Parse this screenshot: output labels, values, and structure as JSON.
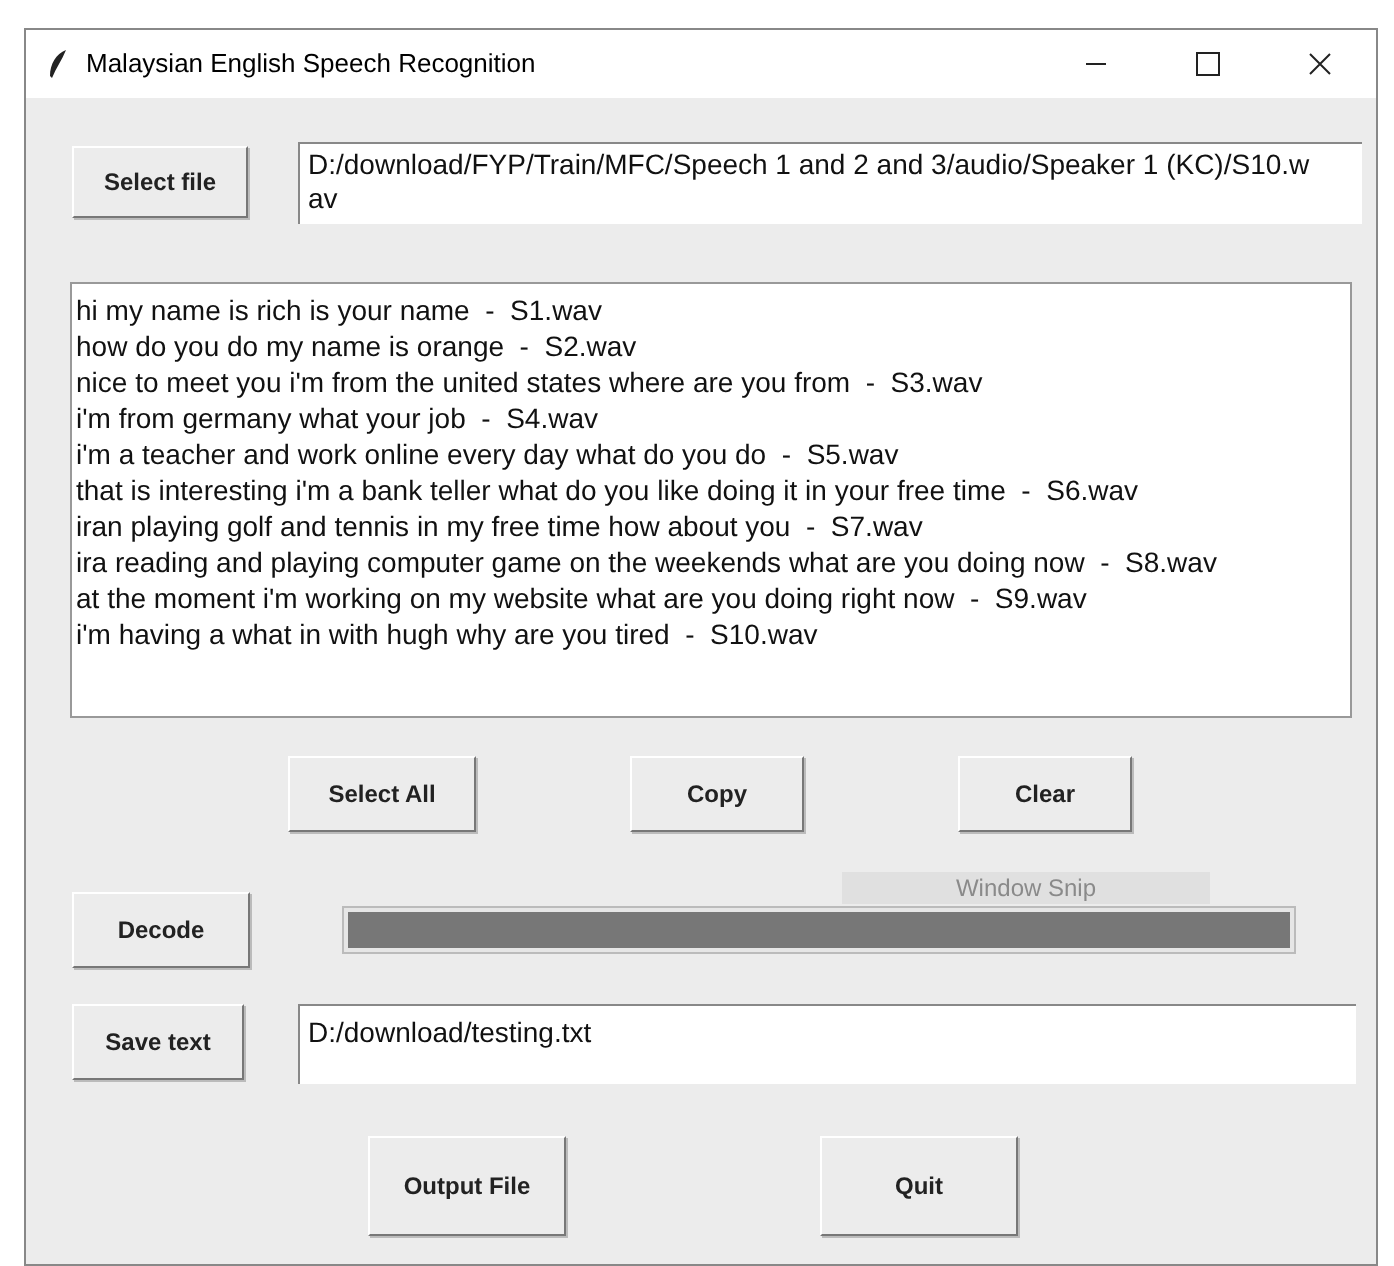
{
  "window": {
    "title": "Malaysian English Speech Recognition"
  },
  "file_button": "Select file",
  "file_path": "D:/download/FYP/Train/MFC/Speech 1 and 2 and 3/audio/Speaker 1 (KC)/S10.wav",
  "results": [
    "hi my name is rich is your name  -  S1.wav",
    "how do you do my name is orange  -  S2.wav",
    "nice to meet you i'm from the united states where are you from  -  S3.wav",
    "i'm from germany what your job  -  S4.wav",
    "i'm a teacher and work online every day what do you do  -  S5.wav",
    "that is interesting i'm a bank teller what do you like doing it in your free time  -  S6.wav",
    "iran playing golf and tennis in my free time how about you  -  S7.wav",
    "ira reading and playing computer game on the weekends what are you doing now  -  S8.wav",
    "at the moment i'm working on my website what are you doing right now  -  S9.wav",
    "i'm having a what in with hugh why are you tired  -  S10.wav"
  ],
  "edit_buttons": [
    "Select All",
    "Copy",
    "Clear"
  ],
  "decode_button": "Decode",
  "progress": {
    "level": 1
  },
  "tooltip": "Window Snip",
  "save_button": "Save text",
  "save_path": "D:/download/testing.txt",
  "bottom_buttons": [
    "Output File",
    "Quit"
  ]
}
